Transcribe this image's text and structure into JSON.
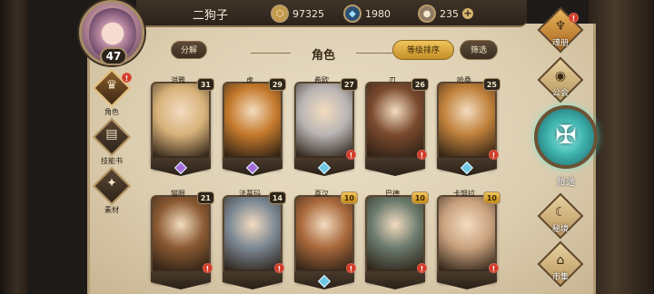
{
  "player": {
    "name": "二狗子",
    "level": "47"
  },
  "resources": {
    "gold": "97325",
    "crystal": "1980",
    "stone": "235",
    "plus": "+"
  },
  "sidebar": {
    "items": [
      {
        "label": "角色",
        "icon": "mask-icon",
        "alert": "!"
      },
      {
        "label": "技能书",
        "icon": "book-icon"
      },
      {
        "label": "素材",
        "icon": "pouch-icon"
      }
    ]
  },
  "header": {
    "dismantle": "分解",
    "title": "角色",
    "sort": "等级排序",
    "filter": "筛选"
  },
  "heroes": [
    {
      "name": "洪雅",
      "level": "31",
      "portrait": "#d7b27a",
      "gem": "purple"
    },
    {
      "name": "虎",
      "level": "29",
      "portrait": "#c57a2c",
      "gem": "purple"
    },
    {
      "name": "希欧",
      "level": "27",
      "portrait": "#b9b5b4",
      "gem": "blue",
      "alert": "!"
    },
    {
      "name": "刃",
      "level": "26",
      "portrait": "#7a4a2e",
      "alert": "!"
    },
    {
      "name": "哈桑",
      "level": "25",
      "portrait": "#c0813b",
      "gem": "blue",
      "alert": "!"
    },
    {
      "name": "猫眼",
      "level": "21",
      "portrait": "#8a5a32",
      "alert": "!"
    },
    {
      "name": "法蒂玛",
      "level": "14",
      "portrait": "#7c8893",
      "alert": "!"
    },
    {
      "name": "喜汉",
      "level": "10",
      "portrait": "#a9693c",
      "gem": "blue",
      "alert": "!"
    },
    {
      "name": "巴德",
      "level": "10",
      "portrait": "#6a7a6c",
      "alert": "!"
    },
    {
      "name": "卡努拉",
      "level": "10",
      "portrait": "#c9a27f",
      "alert": "!"
    }
  ],
  "right_nav": {
    "soulbook": {
      "label": "魂册",
      "alert": "!"
    },
    "guild": {
      "label": "公会"
    },
    "journey": {
      "label": "旅途"
    },
    "mystic": {
      "label": "秘境"
    },
    "market": {
      "label": "市集"
    }
  }
}
